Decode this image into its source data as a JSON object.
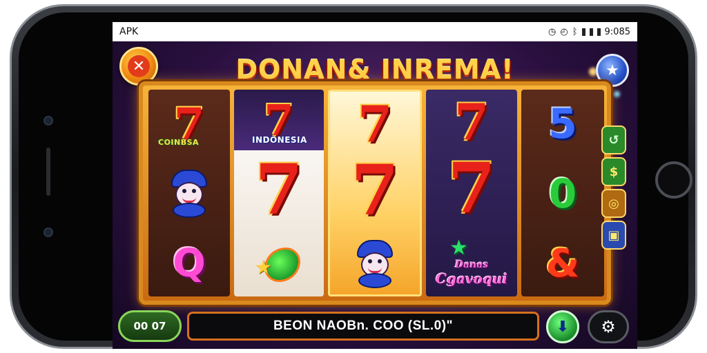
{
  "statusbar": {
    "carrier": "APK",
    "time": "9:085"
  },
  "game": {
    "title": "DONAN& INREMA!",
    "close_icon": "close-icon",
    "menu_icon": "star-menu-icon"
  },
  "reels": {
    "reel1": {
      "top_label": "COINBSA",
      "bottom_symbol": "Q"
    },
    "reel2": {
      "top_label": "INDONESIA"
    },
    "reel4": {
      "badge_line1": "Danas",
      "badge_line2": "Cgavoqui"
    },
    "reel5": {
      "top_symbol": "5",
      "middle_symbol": "0",
      "bottom_symbol": "&"
    },
    "seven": "7"
  },
  "side_panel": {
    "btn1": "↺",
    "btn2": "$",
    "btn3": "◎",
    "btn4": "▣"
  },
  "bottom": {
    "bet_label": "00 07",
    "message": "BEON NAOBn. COO (SL.0)\"",
    "spin_icon": "spin-icon",
    "settings_icon": "gear-icon"
  },
  "colors": {
    "accent_gold": "#ffd24a",
    "accent_orange": "#d6711c",
    "seven_red": "#e8221a"
  }
}
